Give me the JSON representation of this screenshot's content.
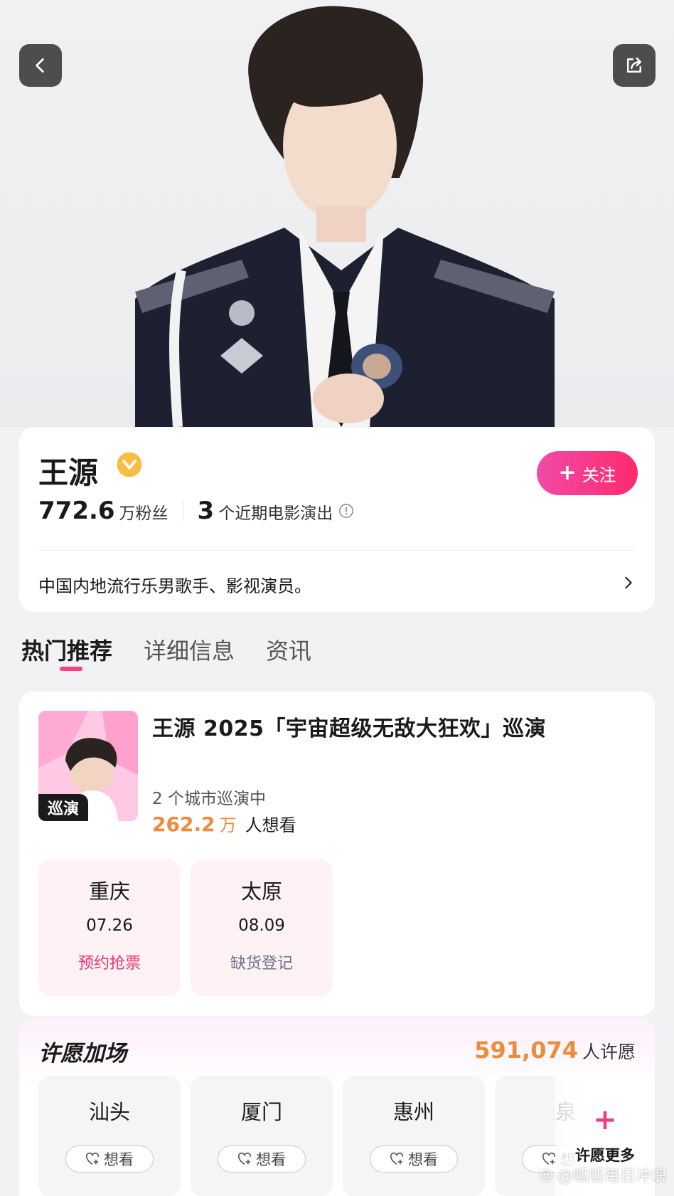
{
  "colors": {
    "accent_pink": "#ff2a6d",
    "orange": "#ef8b3b",
    "stop_bg": "#fff2f4"
  },
  "hero": {
    "back_icon": "chevron-left-icon",
    "share_icon": "share-icon"
  },
  "profile": {
    "name": "王源",
    "verified_icon": "verified-badge-icon",
    "follow_label": "关注",
    "follow_icon": "plus-icon",
    "fans_count": "772.6",
    "fans_unit": "万粉丝",
    "shows_count": "3",
    "shows_text": "个近期电影演出",
    "bio": "中国内地流行乐男歌手、影视演员。"
  },
  "tabs": [
    {
      "label": "热门推荐",
      "active": true
    },
    {
      "label": "详细信息",
      "active": false
    },
    {
      "label": "资讯",
      "active": false
    }
  ],
  "tour": {
    "badge": "巡演",
    "title": "王源 2025「宇宙超级无敌大狂欢」巡演",
    "cities_text": "2 个城市巡演中",
    "want_num": "262.2",
    "want_unit": "万",
    "want_text": "人想看",
    "stops": [
      {
        "city": "重庆",
        "date": "07.26",
        "action": "预约抢票"
      },
      {
        "city": "太原",
        "date": "08.09",
        "action": "缺货登记"
      }
    ]
  },
  "wish": {
    "title": "许愿加场",
    "count": "591,074",
    "count_text": "人许愿",
    "cities": [
      {
        "city": "汕头",
        "button": "想看"
      },
      {
        "city": "厦门",
        "button": "想看"
      },
      {
        "city": "惠州",
        "button": "想看"
      },
      {
        "city": "泉",
        "button": "想看"
      }
    ],
    "more_label": "许愿更多"
  },
  "watermark": "@呱呱每日冲浪"
}
